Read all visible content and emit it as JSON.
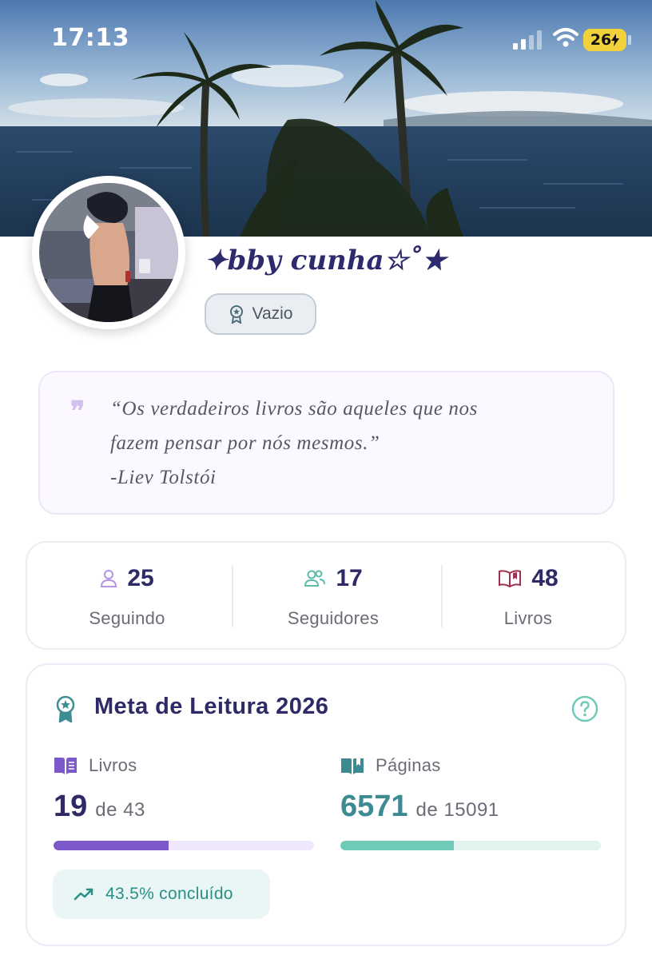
{
  "status_bar": {
    "time": "17:13",
    "battery": "26"
  },
  "profile": {
    "username": "✦bby cunha☆˚★",
    "badge_label": "Vazio"
  },
  "quote": {
    "lines": [
      "“Os verdadeiros livros são aqueles que nos",
      "fazem pensar por nós mesmos.”",
      "-Liev Tolstói"
    ]
  },
  "stats": [
    {
      "value": "25",
      "label": "Seguindo",
      "icon": "user-icon"
    },
    {
      "value": "17",
      "label": "Seguidores",
      "icon": "users-icon"
    },
    {
      "value": "48",
      "label": "Livros",
      "icon": "open-book-icon"
    }
  ],
  "reading_goal": {
    "title": "Meta de Leitura 2026",
    "books": {
      "label": "Livros",
      "current": "19",
      "of_text": "de 43",
      "progress": 0.4419
    },
    "pages": {
      "label": "Páginas",
      "current": "6571",
      "of_text": "de 15091",
      "progress": 0.4354
    },
    "completion_text": "43.5% concluído"
  },
  "colors": {
    "accent_purple": "#7b59c9",
    "purple_track": "#efe8fb",
    "accent_teal": "#6fcab8",
    "teal_track": "#e2f4f0",
    "teal_text": "#3e8a92",
    "title_navy": "#2d2a66"
  }
}
